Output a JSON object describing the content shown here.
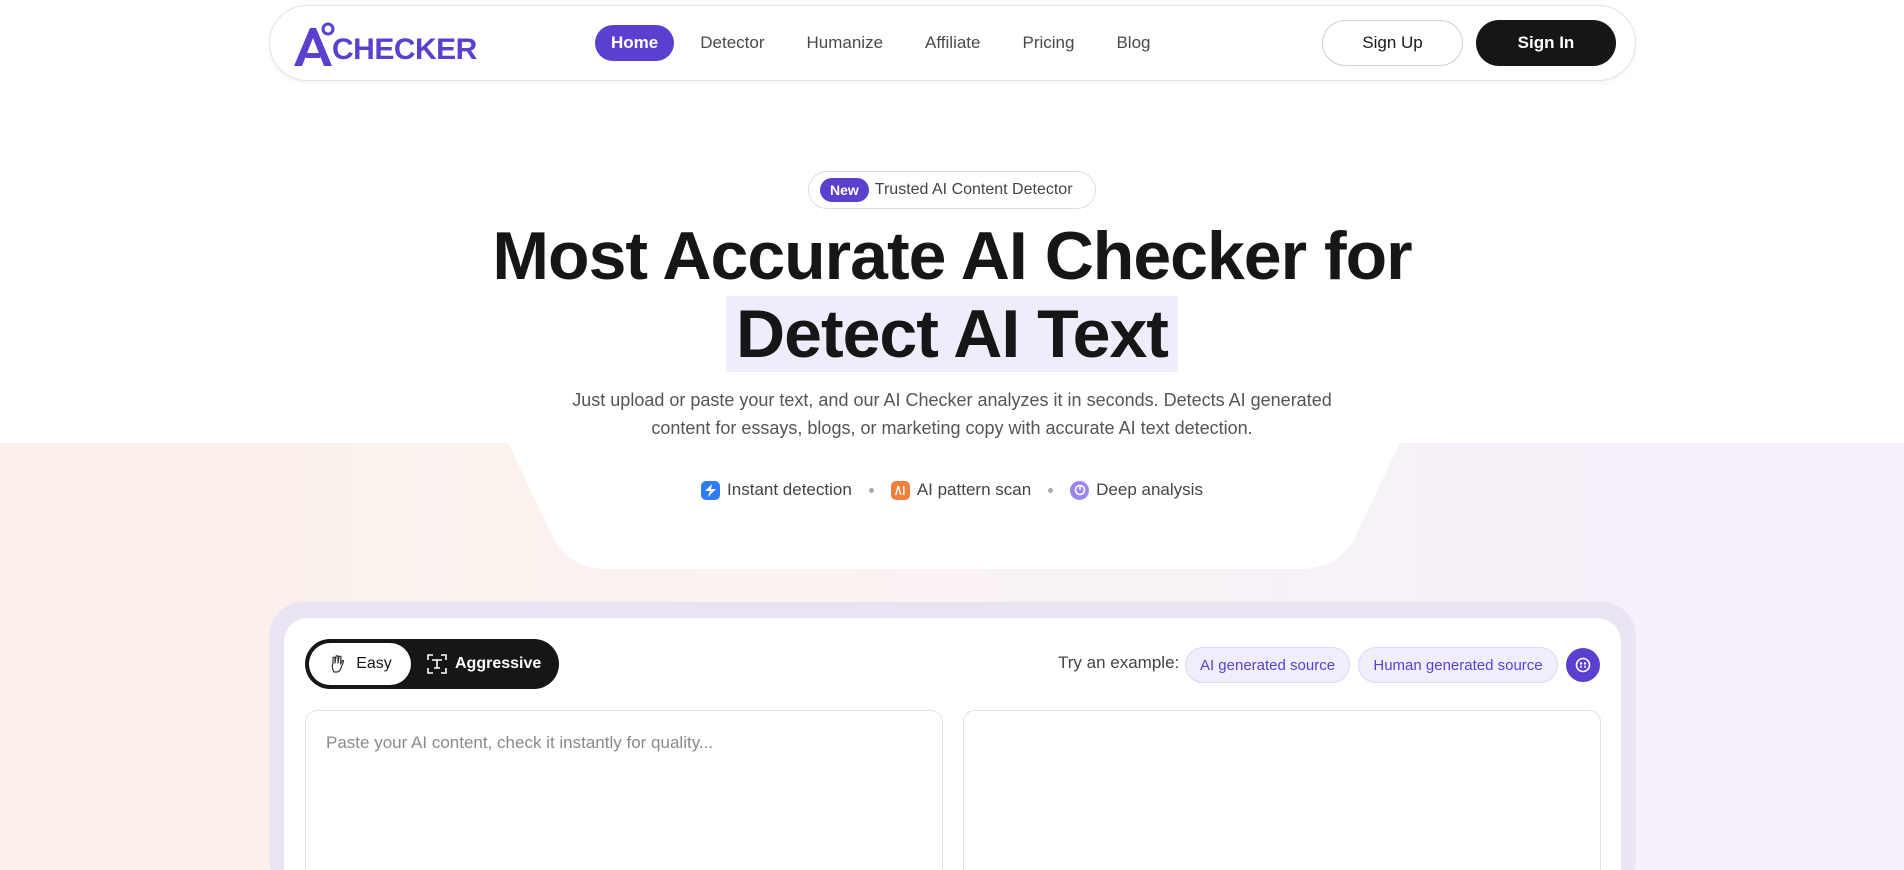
{
  "brand": {
    "logo_text": "CHECKER",
    "accent": "#5b3fcf",
    "dark": "#161616"
  },
  "nav": {
    "items": [
      {
        "label": "Home",
        "active": true
      },
      {
        "label": "Detector",
        "active": false
      },
      {
        "label": "Humanize",
        "active": false
      },
      {
        "label": "Affiliate",
        "active": false
      },
      {
        "label": "Pricing",
        "active": false
      },
      {
        "label": "Blog",
        "active": false
      }
    ],
    "sign_up": "Sign Up",
    "sign_in": "Sign In"
  },
  "hero": {
    "badge_new": "New",
    "badge_text": "Trusted AI Content Detector",
    "title_line1": "Most Accurate AI Checker for",
    "title_line2": "Detect AI Text",
    "subtitle_line1": "Just upload or paste your text, and our AI Checker analyzes it in seconds. Detects AI generated",
    "subtitle_line2": "content for essays, blogs, or marketing copy with accurate AI text detection.",
    "features": [
      {
        "label": "Instant detection",
        "icon": "lightning-icon",
        "color": "#2f7df6"
      },
      {
        "label": "AI pattern scan",
        "icon": "ai-chip-icon",
        "color": "#f2803a"
      },
      {
        "label": "Deep analysis",
        "icon": "gauge-icon",
        "color": "#9b86ef"
      }
    ]
  },
  "tool": {
    "modes": [
      {
        "label": "Easy",
        "selected": true,
        "icon": "hand-icon"
      },
      {
        "label": "Aggressive",
        "selected": false,
        "icon": "scan-text-icon"
      }
    ],
    "try_label": "Try an example:",
    "examples": [
      "AI generated source",
      "Human generated source"
    ],
    "extra_icon": "dice-icon",
    "input_placeholder": "Paste your AI content, check it instantly for quality..."
  }
}
